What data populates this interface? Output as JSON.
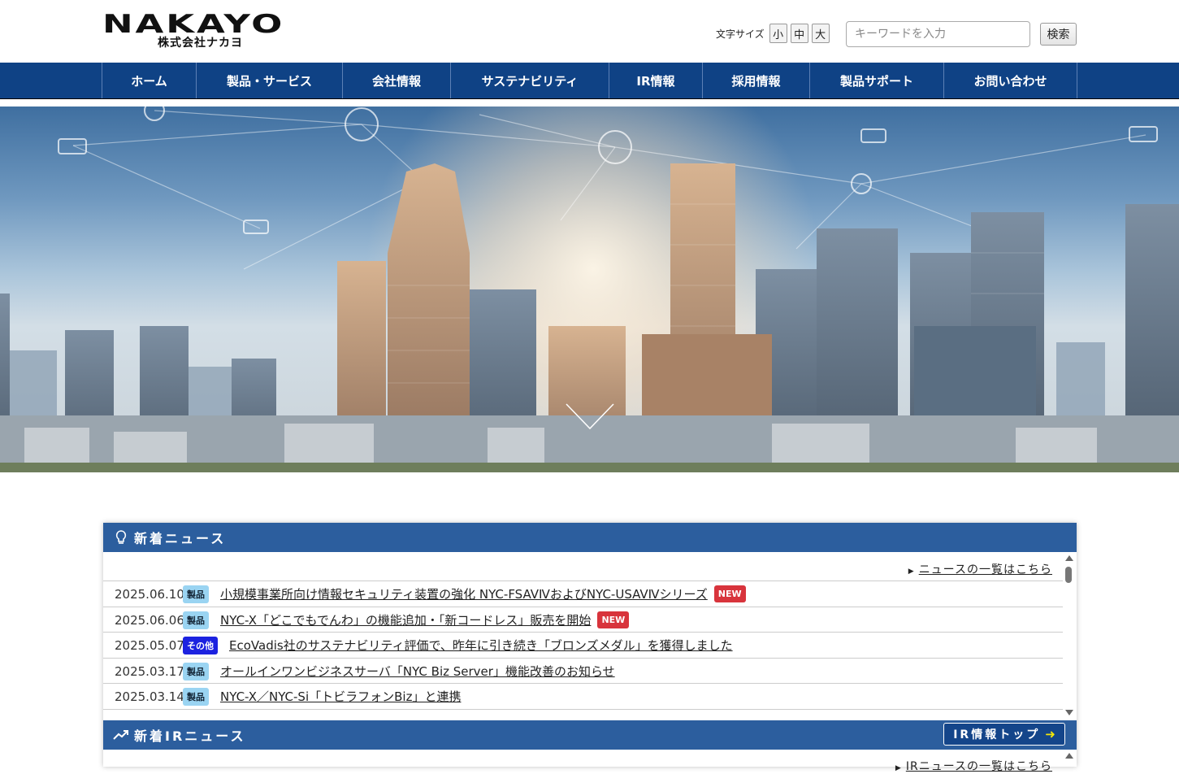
{
  "header": {
    "logo_main": "NAKAYO",
    "logo_sub": "株式会社ナカヨ",
    "font_size_label": "文字サイズ",
    "font_sizes": [
      "小",
      "中",
      "大"
    ],
    "search_placeholder": "キーワードを入力",
    "search_button": "検索"
  },
  "nav": {
    "items": [
      {
        "label": "ホーム"
      },
      {
        "label": "製品・サービス"
      },
      {
        "label": "会社情報"
      },
      {
        "label": "サステナビリティ"
      },
      {
        "label": "IR情報"
      },
      {
        "label": "採用情報"
      },
      {
        "label": "製品サポート"
      },
      {
        "label": "お問い合わせ"
      }
    ]
  },
  "news": {
    "heading": "新着ニュース",
    "list_link": "ニュースの一覧はこちら",
    "new_label": "NEW",
    "items": [
      {
        "date": "2025.06.10",
        "category": "製品",
        "title": "小規模事業所向け情報セキュリティ装置の強化 NYC-FSAVⅣおよびNYC-USAVⅣシリーズ",
        "is_new": true
      },
      {
        "date": "2025.06.06",
        "category": "製品",
        "title": "NYC-X「どこでもでんわ」の機能追加・「新コードレス」販売を開始",
        "is_new": true
      },
      {
        "date": "2025.05.07",
        "category": "その他",
        "title": "EcoVadis社のサステナビリティ評価で、昨年に引き続き「ブロンズメダル」を獲得しました",
        "is_new": false
      },
      {
        "date": "2025.03.17",
        "category": "製品",
        "title": "オールインワンビジネスサーバ「NYC Biz Server」機能改善のお知らせ",
        "is_new": false
      },
      {
        "date": "2025.03.14",
        "category": "製品",
        "title": "NYC-X／NYC-Si「トビラフォンBiz」と連携",
        "is_new": false
      }
    ]
  },
  "ir_news": {
    "heading": "新着IRニュース",
    "top_button": "IR情報トップ",
    "list_link": "IRニュースの一覧はこちら"
  },
  "colors": {
    "nav_bg": "#0f4285",
    "bar_bg": "#2c5e9e",
    "new_badge": "#d8343c",
    "category_product": "#9ad4f2",
    "category_other": "#1c22e0"
  }
}
